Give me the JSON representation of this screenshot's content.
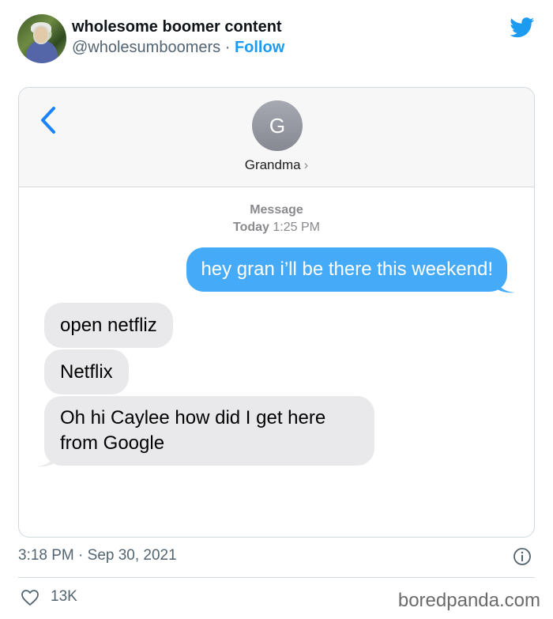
{
  "tweet": {
    "display_name": "wholesome boomer content",
    "handle": "@wholesumboomers",
    "separator": " · ",
    "follow_label": "Follow",
    "timestamp": "3:18 PM · Sep 30, 2021",
    "likes": "13K",
    "brand_color": "#1d9bf0"
  },
  "imessage": {
    "contact_initial": "G",
    "contact_name": "Grandma",
    "contact_chevron": "›",
    "service_label": "Message",
    "time_bold": "Today",
    "time_rest": " 1:25 PM",
    "outgoing_color": "#45aaf7",
    "incoming_color": "#e9e9eb",
    "messages": [
      {
        "direction": "outgoing",
        "text": "hey gran i’ll be there this weekend!"
      },
      {
        "direction": "incoming",
        "text": "open netfliz"
      },
      {
        "direction": "incoming",
        "text": "Netflix"
      },
      {
        "direction": "incoming",
        "text": "Oh hi Caylee how did I get here from Google"
      }
    ]
  },
  "icons": {
    "bird": "twitter-bird-icon",
    "back": "chevron-left-icon",
    "info": "info-icon",
    "like": "heart-icon"
  },
  "watermark": "boredpanda.com"
}
